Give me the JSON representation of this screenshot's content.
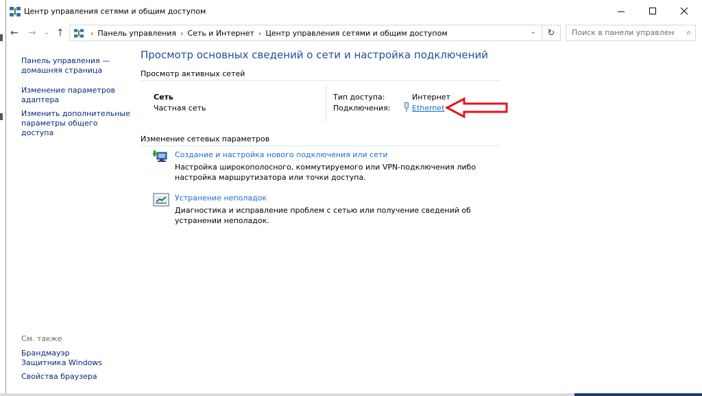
{
  "window": {
    "title": "Центр управления сетями и общим доступом",
    "minimize_icon": "minimize-icon",
    "maximize_icon": "maximize-icon",
    "close_icon": "close-icon"
  },
  "nav": {
    "back_icon": "arrow-left-icon",
    "forward_icon": "arrow-right-icon",
    "recent_icon": "chevron-down-icon",
    "up_icon": "arrow-up-icon"
  },
  "address": {
    "crumbs": [
      "Панель управления",
      "Сеть и Интернет",
      "Центр управления сетями и общим доступом"
    ],
    "separator": "›"
  },
  "search": {
    "placeholder": "Поиск в панели управления"
  },
  "sidebar": {
    "home": "Панель управления — домашняя страница",
    "adapter": "Изменение параметров адаптера",
    "sharing": "Изменить дополнительные параметры общего доступа",
    "see_also": "См. также",
    "firewall": "Брандмауэр Защитника Windows",
    "browser": "Свойства браузера"
  },
  "main": {
    "title": "Просмотр основных сведений о сети и настройка подключений",
    "active_header": "Просмотр активных сетей",
    "network_name": "Сеть",
    "network_type": "Частная сеть",
    "access_label": "Тип доступа:",
    "access_value": "Интернет",
    "connections_label": "Подключения:",
    "connection_link": "Ethernet",
    "change_header": "Изменение сетевых параметров",
    "task1_link": "Создание и настройка нового подключения или сети",
    "task1_desc": "Настройка широкополосного, коммутируемого или VPN-подключения либо настройка маршрутизатора или точки доступа.",
    "task2_link": "Устранение неполадок",
    "task2_desc": "Диагностика и исправление проблем с сетью или получение сведений об устранении неполадок."
  },
  "colors": {
    "link": "#1a6dd6",
    "title_blue": "#1e4e9e",
    "annotation_arrow": "#e8141c"
  }
}
